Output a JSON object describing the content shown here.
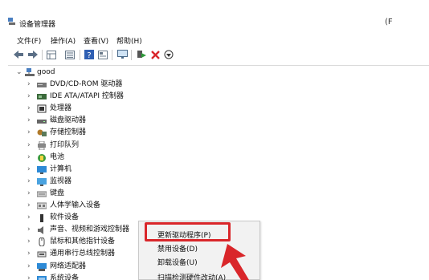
{
  "window": {
    "title": "设备管理器",
    "minimize_glyph": "(F"
  },
  "menu": {
    "items": [
      "文件(F)",
      "操作(A)",
      "查看(V)",
      "帮助(H)"
    ]
  },
  "toolbar": {
    "icons": [
      "back-arrow-icon",
      "forward-arrow-icon",
      "properties-grid-icon",
      "refresh-list-icon",
      "help-icon",
      "properties-icon",
      "monitor-icon",
      "enable-device-icon",
      "uninstall-x-icon",
      "update-driver-icon"
    ],
    "accent_red": "#d9262a",
    "accent_green": "#2e9b3a"
  },
  "tree": {
    "root": {
      "label": "good",
      "icon": "computer-icon"
    },
    "items": [
      {
        "label": "DVD/CD-ROM 驱动器",
        "icon": "dvd-drive-icon"
      },
      {
        "label": "IDE ATA/ATAPI 控制器",
        "icon": "ide-controller-icon"
      },
      {
        "label": "处理器",
        "icon": "processor-icon"
      },
      {
        "label": "磁盘驱动器",
        "icon": "disk-drive-icon"
      },
      {
        "label": "存储控制器",
        "icon": "storage-controller-icon"
      },
      {
        "label": "打印队列",
        "icon": "printer-icon"
      },
      {
        "label": "电池",
        "icon": "battery-icon"
      },
      {
        "label": "计算机",
        "icon": "computer-monitor-icon"
      },
      {
        "label": "监视器",
        "icon": "monitor-icon"
      },
      {
        "label": "键盘",
        "icon": "keyboard-icon"
      },
      {
        "label": "人体学输入设备",
        "icon": "hid-icon"
      },
      {
        "label": "软件设备",
        "icon": "software-device-icon"
      },
      {
        "label": "声音、视频和游戏控制器",
        "icon": "speaker-icon"
      },
      {
        "label": "鼠标和其他指针设备",
        "icon": "mouse-icon"
      },
      {
        "label": "通用串行总线控制器",
        "icon": "usb-icon"
      },
      {
        "label": "网络适配器",
        "icon": "network-adapter-icon"
      },
      {
        "label": "系统设备",
        "icon": "system-device-icon"
      }
    ]
  },
  "context_menu": {
    "items": [
      "更新驱动程序(P)",
      "禁用设备(D)",
      "卸载设备(U)",
      "扫描检测硬件改动(A)"
    ],
    "highlight_color": "#d9262a"
  }
}
